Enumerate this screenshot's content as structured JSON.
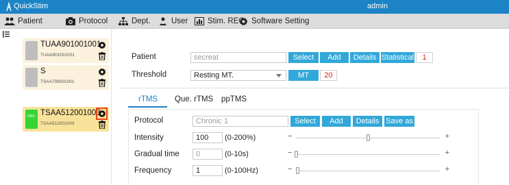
{
  "titlebar": {
    "app_name": "QuickStim",
    "user": "admin",
    "background": "#1c84c6"
  },
  "menu": [
    {
      "label": "Patient",
      "icon": "users-icon"
    },
    {
      "label": "Protocol",
      "icon": "camera-icon"
    },
    {
      "label": "Dept.",
      "icon": "sitemap-icon"
    },
    {
      "label": "User",
      "icon": "user-group-icon"
    },
    {
      "label": "Stim. REC",
      "icon": "bar-chart-icon"
    },
    {
      "label": "Software Setting",
      "icon": "gear-icon"
    }
  ],
  "sidebar": {
    "patients": [
      {
        "name": "TUAA901001001",
        "code": "TUAA901001001",
        "thumb_label": "",
        "selected": false
      },
      {
        "name": "S",
        "code": "TSAA708001001",
        "thumb_label": "",
        "selected": false
      },
      {
        "name": "TSAA512001003",
        "code": "TSAA512001003",
        "thumb_label": "FMS",
        "selected": true
      }
    ]
  },
  "patient_row": {
    "label": "Patient",
    "value": "secreat",
    "buttons": [
      "Select",
      "Add",
      "Details",
      "Statistical"
    ],
    "count": "1"
  },
  "threshold_row": {
    "label": "Threshold",
    "selected": "Resting MT.",
    "button": "MT",
    "value": "20"
  },
  "tabs": [
    {
      "label": "rTMS",
      "active": true
    },
    {
      "label": "Que. rTMS",
      "active": false
    },
    {
      "label": "ppTMS",
      "active": false
    }
  ],
  "protocol": {
    "label": "Protocol",
    "value": "Chronic 1",
    "buttons": [
      "Select",
      "Add",
      "Details",
      "Save as"
    ]
  },
  "params": [
    {
      "label": "Intensity",
      "value": "100",
      "range": "(0-200%)",
      "placeholder": false,
      "level": 0.5
    },
    {
      "label": "Gradual time",
      "value": "0",
      "range": "(0-10s)",
      "placeholder": true,
      "level": 0.0
    },
    {
      "label": "Frequency",
      "value": "1",
      "range": "(0-100Hz)",
      "placeholder": false,
      "level": 0.01
    }
  ],
  "colors": {
    "accent": "#31a8d9",
    "tab_active": "#1d7fc2",
    "highlight": "#e8471a",
    "alert": "#e02020"
  }
}
